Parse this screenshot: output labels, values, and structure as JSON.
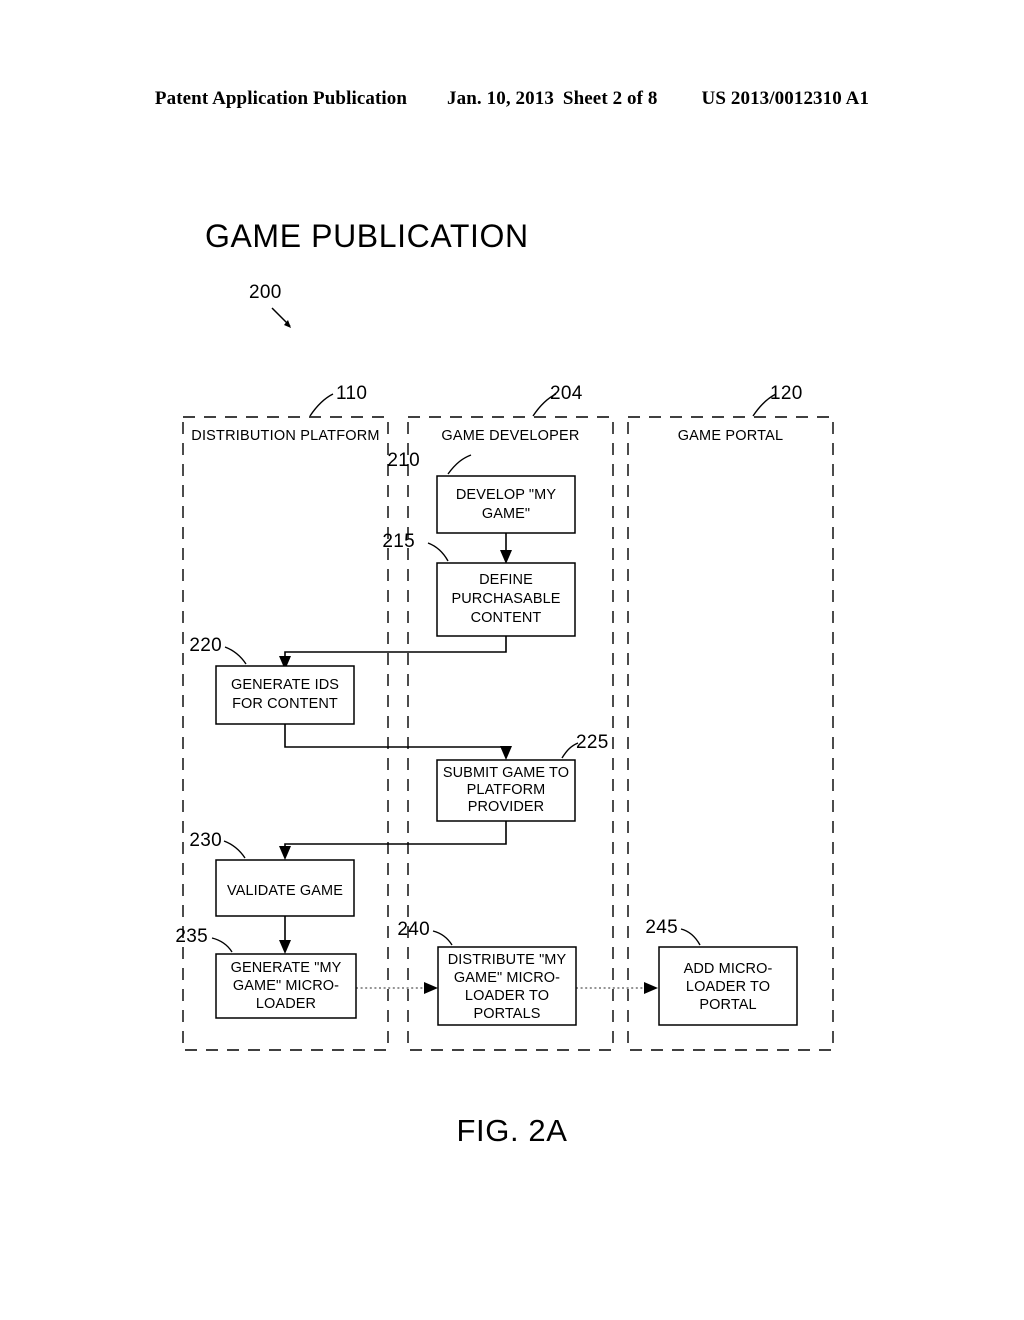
{
  "header": {
    "publication": "Patent Application Publication",
    "date": "Jan. 10, 2013",
    "sheet": "Sheet 2 of 8",
    "number": "US 2013/0012310 A1"
  },
  "figure": {
    "title": "GAME PUBLICATION",
    "caption": "FIG. 2A",
    "diagram_ref": "200"
  },
  "lanes": [
    {
      "id": "distribution-platform",
      "label": "DISTRIBUTION PLATFORM",
      "ref": "110"
    },
    {
      "id": "game-developer",
      "label": "GAME DEVELOPER",
      "ref": "204"
    },
    {
      "id": "game-portal",
      "label": "GAME PORTAL",
      "ref": "120"
    }
  ],
  "nodes": [
    {
      "id": "develop-my-game",
      "ref": "210",
      "lane": "game-developer",
      "lines": [
        "DEVELOP \"MY",
        "GAME\""
      ]
    },
    {
      "id": "define-content",
      "ref": "215",
      "lane": "game-developer",
      "lines": [
        "DEFINE",
        "PURCHASABLE",
        "CONTENT"
      ]
    },
    {
      "id": "generate-ids",
      "ref": "220",
      "lane": "distribution-platform",
      "lines": [
        "GENERATE IDS",
        "FOR CONTENT"
      ]
    },
    {
      "id": "submit-game",
      "ref": "225",
      "lane": "game-developer",
      "lines": [
        "SUBMIT GAME TO",
        "PLATFORM",
        "PROVIDER"
      ]
    },
    {
      "id": "validate-game",
      "ref": "230",
      "lane": "distribution-platform",
      "lines": [
        "VALIDATE GAME"
      ]
    },
    {
      "id": "generate-microloader",
      "ref": "235",
      "lane": "distribution-platform",
      "lines": [
        "GENERATE \"MY",
        "GAME\" MICRO-",
        "LOADER"
      ]
    },
    {
      "id": "distribute-microloader",
      "ref": "240",
      "lane": "game-developer",
      "lines": [
        "DISTRIBUTE \"MY",
        "GAME\" MICRO-",
        "LOADER TO",
        "PORTALS"
      ]
    },
    {
      "id": "add-microloader",
      "ref": "245",
      "lane": "game-portal",
      "lines": [
        "ADD MICRO-",
        "LOADER TO",
        "PORTAL"
      ]
    }
  ],
  "flows": [
    {
      "from": "develop-my-game",
      "to": "define-content",
      "style": "solid"
    },
    {
      "from": "define-content",
      "to": "generate-ids",
      "style": "solid"
    },
    {
      "from": "generate-ids",
      "to": "submit-game",
      "style": "solid"
    },
    {
      "from": "submit-game",
      "to": "validate-game",
      "style": "solid"
    },
    {
      "from": "validate-game",
      "to": "generate-microloader",
      "style": "solid"
    },
    {
      "from": "generate-microloader",
      "to": "distribute-microloader",
      "style": "dotted"
    },
    {
      "from": "distribute-microloader",
      "to": "add-microloader",
      "style": "dotted"
    }
  ],
  "colors": {
    "ink": "#000000",
    "paper": "#ffffff",
    "dotted_flow": "#555555"
  }
}
